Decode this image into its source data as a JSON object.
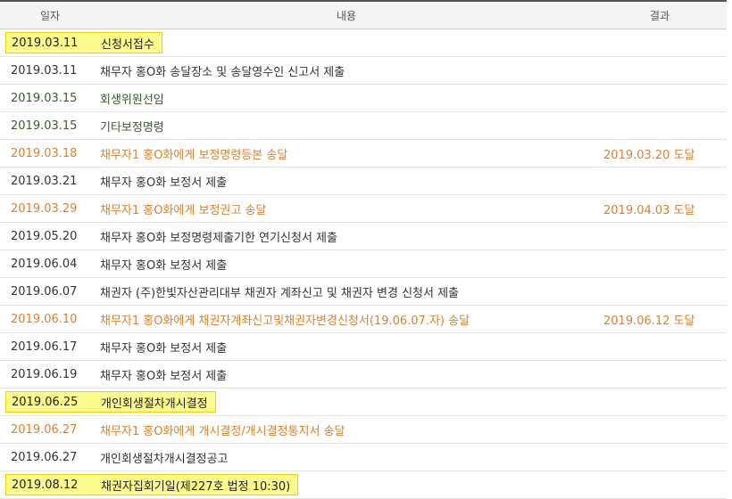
{
  "header": {
    "date": "일자",
    "content": "내용",
    "result": "결과"
  },
  "rows": [
    {
      "date": "2019.03.11",
      "content": "신청서접수",
      "result": "",
      "style": "hl"
    },
    {
      "date": "2019.03.11",
      "content": "채무자 홍O화 송달장소 및 송달영수인 신고서 제출",
      "result": "",
      "style": "dark"
    },
    {
      "date": "2019.03.15",
      "content": "회생위원선임",
      "result": "",
      "style": "green"
    },
    {
      "date": "2019.03.15",
      "content": "기타보정명령",
      "result": "",
      "style": "green"
    },
    {
      "date": "2019.03.18",
      "content": "채무자1 홍O화에게 보정명령등본 송달",
      "result": "2019.03.20 도달",
      "style": "orange"
    },
    {
      "date": "2019.03.21",
      "content": "채무자 홍O화 보정서 제출",
      "result": "",
      "style": "dark"
    },
    {
      "date": "2019.03.29",
      "content": "채무자1 홍O화에게 보정권고 송달",
      "result": "2019.04.03 도달",
      "style": "orange"
    },
    {
      "date": "2019.05.20",
      "content": "채무자 홍O화 보정명령제출기한 연기신청서 제출",
      "result": "",
      "style": "dark"
    },
    {
      "date": "2019.06.04",
      "content": "채무자 홍O화 보정서 제출",
      "result": "",
      "style": "dark"
    },
    {
      "date": "2019.06.07",
      "content": "채권자 (주)한빛자산관리대부 채권자 계좌신고 및 채권자 변경 신청서 제출",
      "result": "",
      "style": "dark"
    },
    {
      "date": "2019.06.10",
      "content": "채무자1 홍O화에게 채권자계좌신고및채권자변경신청서(19.06.07.자) 송달",
      "result": "2019.06.12 도달",
      "style": "orange"
    },
    {
      "date": "2019.06.17",
      "content": "채무자 홍O화 보정서 제출",
      "result": "",
      "style": "dark"
    },
    {
      "date": "2019.06.19",
      "content": "채무자 홍O화 보정서 제출",
      "result": "",
      "style": "dark"
    },
    {
      "date": "2019.06.25",
      "content": "개인회생절차개시결정",
      "result": "",
      "style": "hl"
    },
    {
      "date": "2019.06.27",
      "content": "채무자1 홍O화에게 개시결정/개시결정통지서 송달",
      "result": "",
      "style": "orange"
    },
    {
      "date": "2019.06.27",
      "content": "개인회생절차개시결정공고",
      "result": "",
      "style": "dark"
    },
    {
      "date": "2019.08.12",
      "content": "채권자집회기일(제227호 법정 10:30)",
      "result": "",
      "style": "hl"
    }
  ],
  "colors": {
    "dark": "#333333",
    "green": "#3c5a32",
    "orange": "#d9822b",
    "highlight": "#fdfa8e",
    "highlight_border": "#f0d200"
  }
}
